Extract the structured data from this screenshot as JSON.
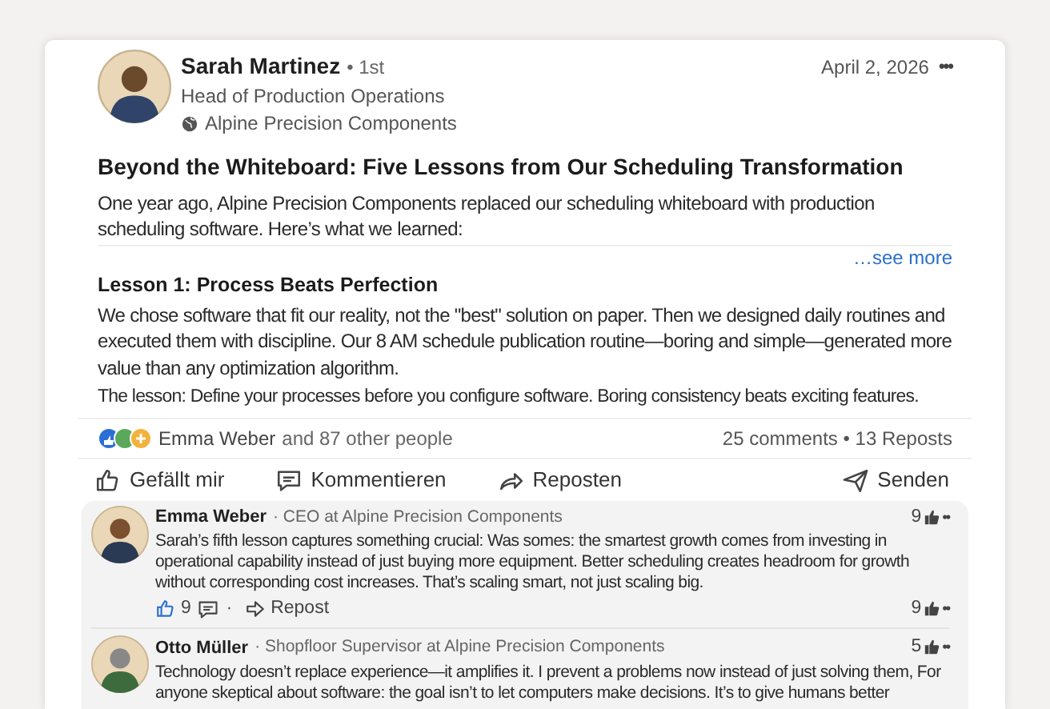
{
  "post": {
    "author": {
      "name": "Sarah Martinez",
      "degree": "• 1st",
      "headline": "Head of Production Operations",
      "company": "Alpine Precision Components"
    },
    "date": "April 2, 2026",
    "menu": "•••",
    "title": "Beyond the Whiteboard: Five Lessons from Our Scheduling Transformation",
    "intro": "One year ago, Alpine Precision Components replaced our scheduling whiteboard with production scheduling software. Here’s what we learned:",
    "see_more": "…see more",
    "lesson_heading": "Lesson 1: Process Beats Perfection",
    "lesson_body": "We chose software that fit our reality, not the \"best\" solution on paper. Then we designed daily routines and executed them with discipline. Our 8 AM schedule publication routine—boring and simple—generated more value than any optimization algorithm.",
    "lesson_takeaway": "The lesson: Define your processes before you configure software. Boring consistency beats exciting features.",
    "reactions": {
      "name": "Emma Weber",
      "others": "and 87 other people",
      "counts": "25 comments • 13 Reposts"
    },
    "actions": [
      {
        "kind": "like",
        "label": "Gefällt mir"
      },
      {
        "kind": "comment",
        "label": "Kommentieren"
      },
      {
        "kind": "repost",
        "label": "Reposten"
      },
      {
        "kind": "send",
        "label": "Senden"
      }
    ]
  },
  "comments": [
    {
      "name": "Emma Weber",
      "headline": "· CEO at Alpine Precision Components",
      "likes": "9",
      "menu": "••",
      "text": "Sarah’s fifth lesson captures something crucial: Was somes: the smartest growth comes from investing in operational capability instead of just buying more equipment. Better scheduling creates headroom for growth without corresponding cost increases. That’s scaling smart, not just scaling big.",
      "footer": {
        "likes": "9",
        "dot": "·",
        "repost": "Repost",
        "right_likes": "9",
        "right_menu": "••"
      }
    },
    {
      "name": "Otto Müller",
      "headline": "· Shopfloor Supervisor at Alpine Precision Components",
      "likes": "5",
      "menu": "••",
      "text": "Technology doesn’t replace experience—it amplifies it. I prevent a problems now instead of just solving them, For anyone skeptical about software: the goal isn’t to let computers make decisions. It’s to give humans better"
    }
  ]
}
